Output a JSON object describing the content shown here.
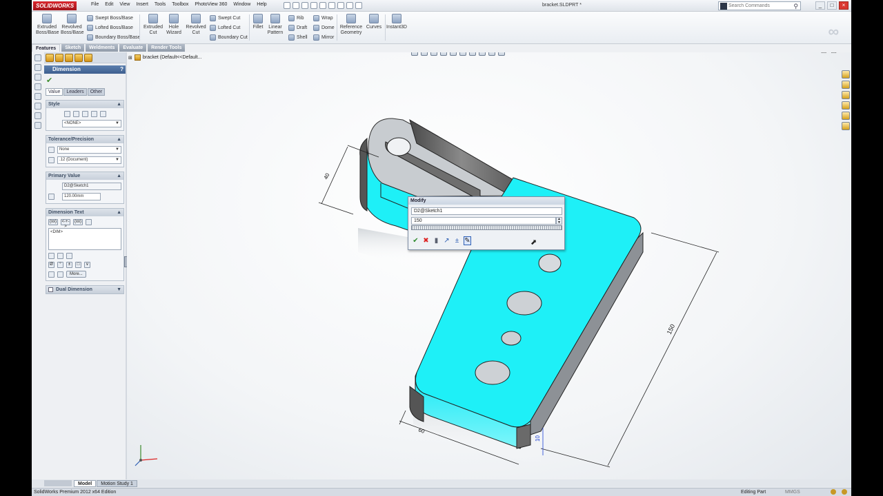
{
  "app": {
    "logo": "SOLIDWORKS",
    "document_title": "bracket.SLDPRT *",
    "search_placeholder": "Search Commands",
    "menu": [
      "File",
      "Edit",
      "View",
      "Insert",
      "Tools",
      "Toolbox",
      "PhotoView 360",
      "Window",
      "Help"
    ]
  },
  "ribbon": {
    "extruded_boss": "Extruded\nBoss/Base",
    "revolved_boss": "Revolved\nBoss/Base",
    "swept_boss": "Swept Boss/Base",
    "lofted_boss": "Lofted Boss/Base",
    "boundary_boss": "Boundary Boss/Base",
    "extruded_cut": "Extruded\nCut",
    "hole_wizard": "Hole\nWizard",
    "revolved_cut": "Revolved\nCut",
    "swept_cut": "Swept Cut",
    "lofted_cut": "Lofted Cut",
    "boundary_cut": "Boundary Cut",
    "fillet": "Fillet",
    "linear_pattern": "Linear\nPattern",
    "rib": "Rib",
    "draft": "Draft",
    "shell": "Shell",
    "wrap": "Wrap",
    "dome": "Dome",
    "mirror": "Mirror",
    "reference_geometry": "Reference\nGeometry",
    "curves": "Curves",
    "instant3d": "Instant3D"
  },
  "tabs": [
    "Features",
    "Sketch",
    "Weldments",
    "Evaluate",
    "Render Tools"
  ],
  "feature_tree": {
    "root": "bracket  (Default<<Default..."
  },
  "property_manager": {
    "title": "Dimension",
    "help": "?",
    "tabs": [
      "Value",
      "Leaders",
      "Other"
    ],
    "style": {
      "title": "Style",
      "value": "<NONE>"
    },
    "tolerance": {
      "title": "Tolerance/Precision",
      "tolerance_value": "None",
      "precision_value": ".12 (Document)"
    },
    "primary_value": {
      "title": "Primary Value",
      "name": "D2@Sketch1",
      "value": "120.00mm"
    },
    "dimension_text": {
      "title": "Dimension Text",
      "buttons": [
        "(xx)",
        "<-+->",
        "(xx)"
      ],
      "text": "<DIM>",
      "more": "More..."
    },
    "dual_dimension": {
      "title": "Dual Dimension"
    }
  },
  "dimensions": {
    "d40": "40",
    "d150": "150",
    "d60": "60",
    "d10": "10"
  },
  "modify_dialog": {
    "title": "Modify",
    "name": "D2@Sketch1",
    "value": "150"
  },
  "model_tabs": [
    "Model",
    "Motion Study 1"
  ],
  "status": {
    "product": "SolidWorks Premium 2012 x64 Edition",
    "mode": "Editing Part",
    "units": "MMGS"
  },
  "colors": {
    "selected_face": "#1ef0f7",
    "accent": "#3e5f8f"
  }
}
